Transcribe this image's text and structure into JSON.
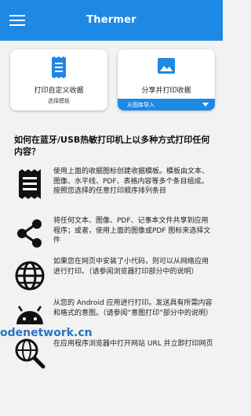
{
  "app": {
    "title": "Thermer"
  },
  "cards": {
    "left": {
      "label": "打印自定义收据",
      "sub": "选择模板"
    },
    "right": {
      "label": "分享并打印收据",
      "dropdown": "从图库导入"
    }
  },
  "question": "如何在蓝牙/USB热敏打印机上以多种方式打印任何内容？",
  "methods": [
    {
      "icon": "receipt-icon",
      "text": "使用上面的收据图标创建收据模板。模板由文本、图像、水平线、PDF、表格内容等多个条目组成。按照您选择的任意打印顺序排列条目"
    },
    {
      "icon": "share-icon",
      "text": "将任何文本、图像、PDF、记事本文件共享到应用程序；或者，使用上面的图像或PDF 图标来选择文件"
    },
    {
      "icon": "globe-icon",
      "text": "如果您在网页中安装了小代码，则可以从网络应用进行打印。（请参阅浏览器打印部分中的说明）"
    },
    {
      "icon": "android-icon",
      "text": "从您的 Android 应用进行打印。发送具有所需内容和格式的意图。（请参阅“意图打印”部分中的说明）"
    },
    {
      "icon": "search-web-icon",
      "text": "在应用程序浏览器中打开网站 URL 并立即打印网页"
    }
  ],
  "watermark": "odenetwork.cn",
  "colors": {
    "primary": "#1e88e5",
    "background": "#f2f2f2"
  }
}
